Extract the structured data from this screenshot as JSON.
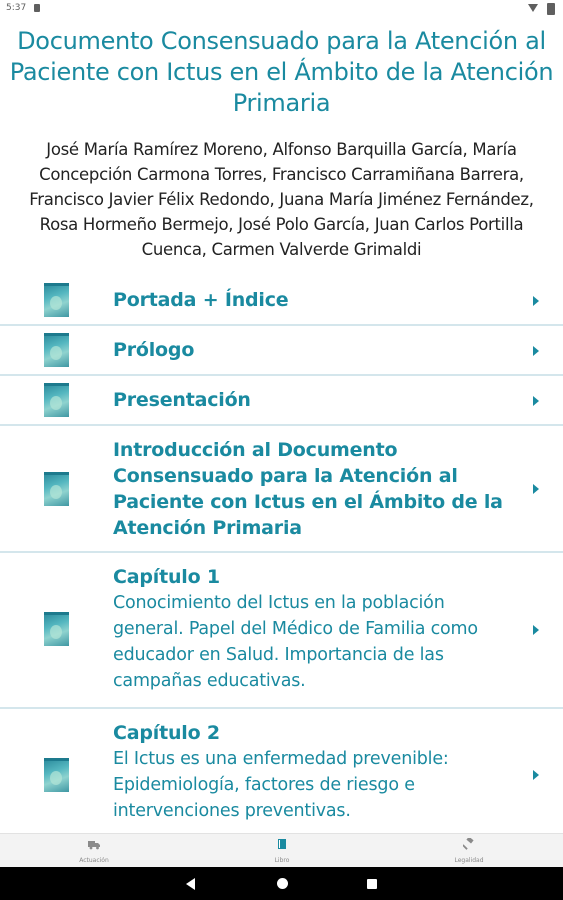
{
  "status_bar": {
    "time": "5:37"
  },
  "book": {
    "title": "Documento Consensuado para la Atención al Paciente con Ictus en el Ámbito de la Atención Primaria",
    "authors": "José María Ramírez Moreno, Alfonso Barquilla García, María Concepción Carmona Torres, Francisco Carramiñana Barrera, Francisco Javier Félix Redondo, Juana María Jiménez Fernández, Rosa Hormeño Bermejo, José Polo García, Juan Carlos Portilla Cuenca, Carmen Valverde Grimaldi"
  },
  "chapters": [
    {
      "title": "Portada + Índice",
      "subtitle": ""
    },
    {
      "title": "Prólogo",
      "subtitle": ""
    },
    {
      "title": "Presentación",
      "subtitle": ""
    },
    {
      "title": "Introducción al Documento Consensuado para la Atención al Paciente con Ictus en el Ámbito de la Atención Primaria",
      "subtitle": ""
    },
    {
      "title": "Capítulo 1",
      "subtitle": "Conocimiento del Ictus en la población general. Papel del Médico de Familia como educador en Salud. Importancia de las campañas educativas."
    },
    {
      "title": "Capítulo 2",
      "subtitle": "El Ictus es una enfermedad prevenible: Epidemiología, factores de riesgo e intervenciones preventivas."
    }
  ],
  "bottom_nav": [
    {
      "label": "Actuación",
      "icon": "ambulance-icon"
    },
    {
      "label": "Libro",
      "icon": "book-icon"
    },
    {
      "label": "Legalidad",
      "icon": "gavel-icon"
    }
  ],
  "colors": {
    "accent": "#1a8aa0",
    "active_nav": "#1a8aa0",
    "inactive_nav": "#8a8a8a",
    "divider": "#d4e6ec"
  }
}
